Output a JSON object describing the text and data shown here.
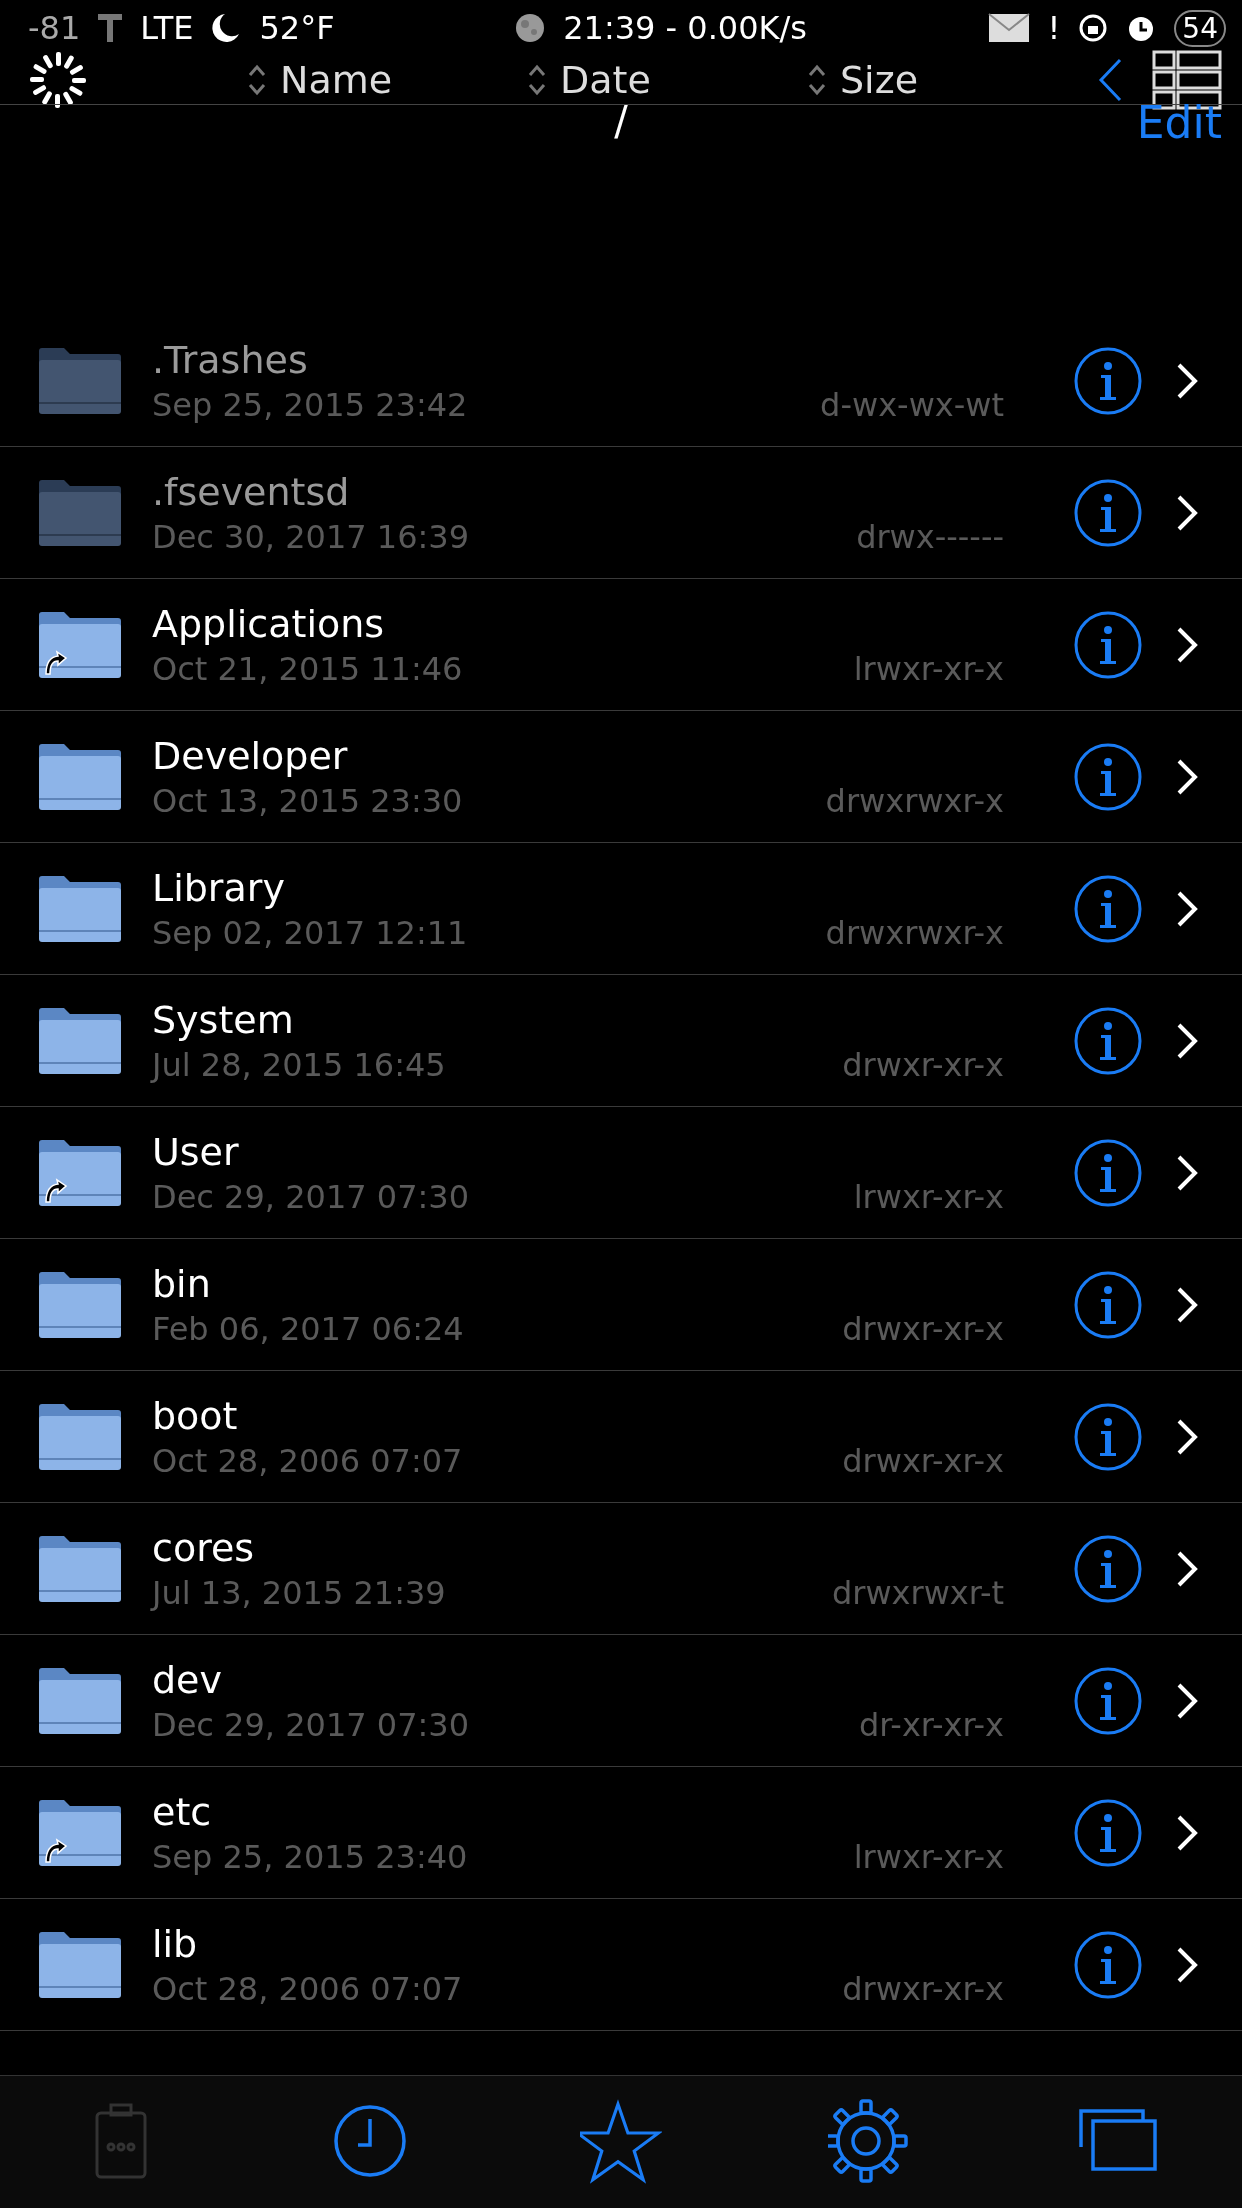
{
  "status_bar": {
    "signal": "-81",
    "network": "LTE",
    "temperature": "52°F",
    "time": "21:39 - 0.00K/s",
    "alert": "!",
    "battery": "54"
  },
  "toolbar": {
    "sort_columns": [
      {
        "label": "Name"
      },
      {
        "label": "Date"
      },
      {
        "label": "Size"
      }
    ],
    "path": "/",
    "edit": "Edit"
  },
  "files": [
    {
      "name": ".Trashes",
      "date": "Sep 25, 2015 23:42",
      "permissions": "d-wx-wx-wt",
      "kind": "folder",
      "hidden": true
    },
    {
      "name": ".fseventsd",
      "date": "Dec 30, 2017 16:39",
      "permissions": "drwx------",
      "kind": "folder",
      "hidden": true
    },
    {
      "name": "Applications",
      "date": "Oct 21, 2015 11:46",
      "permissions": "lrwxr-xr-x",
      "kind": "symlink",
      "hidden": false
    },
    {
      "name": "Developer",
      "date": "Oct 13, 2015 23:30",
      "permissions": "drwxrwxr-x",
      "kind": "folder",
      "hidden": false
    },
    {
      "name": "Library",
      "date": "Sep 02, 2017 12:11",
      "permissions": "drwxrwxr-x",
      "kind": "folder",
      "hidden": false
    },
    {
      "name": "System",
      "date": "Jul 28, 2015 16:45",
      "permissions": "drwxr-xr-x",
      "kind": "folder",
      "hidden": false
    },
    {
      "name": "User",
      "date": "Dec 29, 2017 07:30",
      "permissions": "lrwxr-xr-x",
      "kind": "symlink",
      "hidden": false
    },
    {
      "name": "bin",
      "date": "Feb 06, 2017 06:24",
      "permissions": "drwxr-xr-x",
      "kind": "folder",
      "hidden": false
    },
    {
      "name": "boot",
      "date": "Oct 28, 2006 07:07",
      "permissions": "drwxr-xr-x",
      "kind": "folder",
      "hidden": false
    },
    {
      "name": "cores",
      "date": "Jul 13, 2015 21:39",
      "permissions": "drwxrwxr-t",
      "kind": "folder",
      "hidden": false
    },
    {
      "name": "dev",
      "date": "Dec 29, 2017 07:30",
      "permissions": "dr-xr-xr-x",
      "kind": "folder",
      "hidden": false
    },
    {
      "name": "etc",
      "date": "Sep 25, 2015 23:40",
      "permissions": "lrwxr-xr-x",
      "kind": "symlink",
      "hidden": false
    },
    {
      "name": "lib",
      "date": "Oct 28, 2006 07:07",
      "permissions": "drwxr-xr-x",
      "kind": "folder",
      "hidden": false
    }
  ],
  "tab_bar": [
    {
      "kind": "clipboard",
      "disabled": true
    },
    {
      "kind": "clock",
      "disabled": false
    },
    {
      "kind": "star",
      "disabled": false
    },
    {
      "kind": "gear",
      "disabled": false
    },
    {
      "kind": "windows",
      "disabled": false
    }
  ]
}
